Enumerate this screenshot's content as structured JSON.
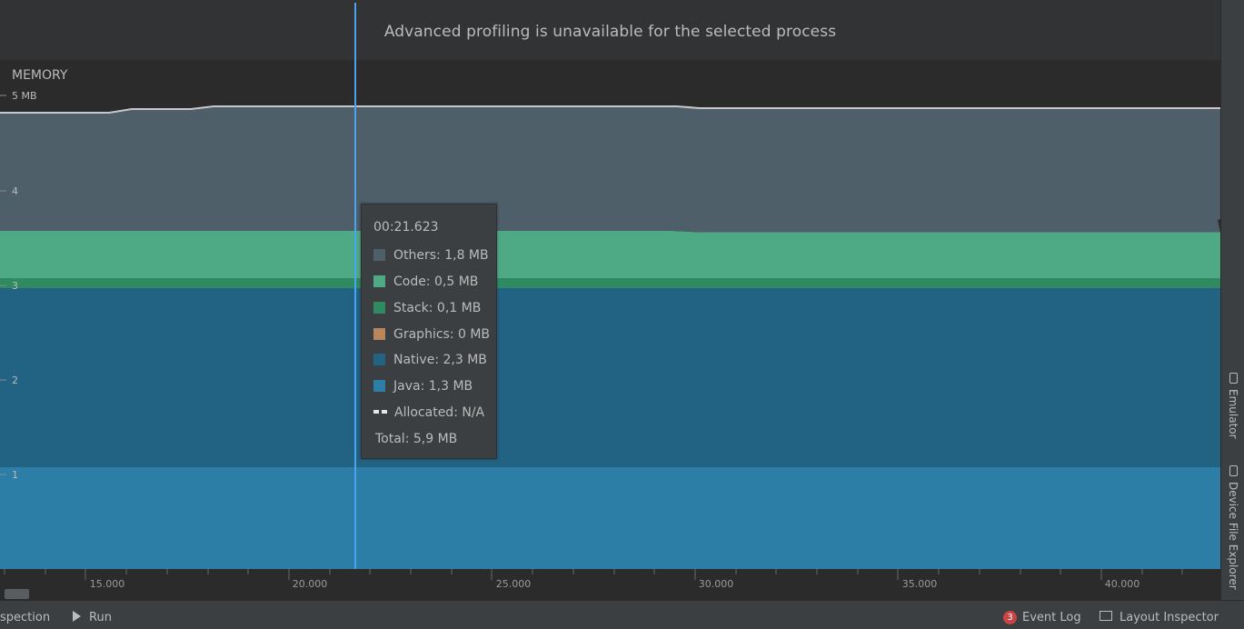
{
  "banner": {
    "message": "Advanced profiling is unavailable for the selected process"
  },
  "memory": {
    "title": "MEMORY",
    "y_max_label": "5 MB",
    "y_ticks": [
      "4",
      "3",
      "2",
      "1"
    ]
  },
  "timeline": {
    "ticks": [
      "15.000",
      "20.000",
      "25.000",
      "30.000",
      "35.000",
      "40.000"
    ]
  },
  "colors": {
    "others": "#4e5f6a",
    "code": "#4ea985",
    "stack": "#2f8a62",
    "graphics": "#b8865b",
    "native": "#226383",
    "java": "#2c7ea6",
    "allocated": "#e6e6e6",
    "cursor": "#4aa3f0"
  },
  "tooltip": {
    "time": "00:21.623",
    "items": [
      {
        "label": "Others: 1,8 MB",
        "color": "#4e5f6a"
      },
      {
        "label": "Code: 0,5 MB",
        "color": "#4ea985"
      },
      {
        "label": "Stack: 0,1 MB",
        "color": "#2f8a62"
      },
      {
        "label": "Graphics: 0 MB",
        "color": "#b8865b"
      },
      {
        "label": "Native: 2,3 MB",
        "color": "#226383"
      },
      {
        "label": "Java: 1,3 MB",
        "color": "#2c7ea6"
      }
    ],
    "allocated": "Allocated: N/A",
    "total": "Total: 5,9 MB"
  },
  "side_tabs": {
    "emulator": "Emulator",
    "device_file_explorer": "Device File Explorer"
  },
  "status_bar": {
    "inspection": "spection",
    "run": "Run",
    "event_log_count": "3",
    "event_log": "Event Log",
    "layout_inspector": "Layout Inspector"
  }
}
